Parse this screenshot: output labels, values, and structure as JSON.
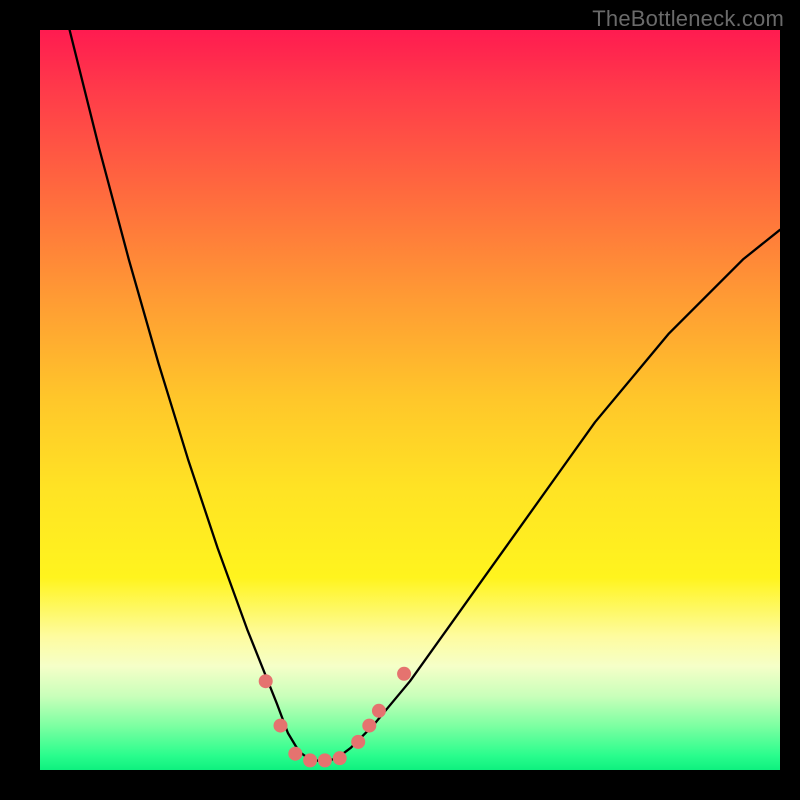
{
  "watermark": "TheBottleneck.com",
  "chart_data": {
    "type": "line",
    "title": "",
    "xlabel": "",
    "ylabel": "",
    "xlim": [
      0,
      100
    ],
    "ylim": [
      0,
      100
    ],
    "grid": false,
    "legend": false,
    "series": [
      {
        "name": "bottleneck-curve",
        "color": "#000000",
        "x": [
          4,
          8,
          12,
          16,
          20,
          24,
          28,
          30,
          32,
          33.5,
          35,
          36.5,
          38,
          40,
          42,
          45,
          50,
          55,
          60,
          65,
          70,
          75,
          80,
          85,
          90,
          95,
          100
        ],
        "y": [
          100,
          84,
          69,
          55,
          42,
          30,
          19,
          14,
          9,
          5,
          2.5,
          1.4,
          1.2,
          1.5,
          3,
          6,
          12,
          19,
          26,
          33,
          40,
          47,
          53,
          59,
          64,
          69,
          73
        ]
      }
    ],
    "markers": {
      "name": "highlight-points",
      "color": "#e5736f",
      "radius": 7,
      "points": [
        {
          "x": 30.5,
          "y": 12
        },
        {
          "x": 32.5,
          "y": 6
        },
        {
          "x": 34.5,
          "y": 2.2
        },
        {
          "x": 36.5,
          "y": 1.3
        },
        {
          "x": 38.5,
          "y": 1.3
        },
        {
          "x": 40.5,
          "y": 1.6
        },
        {
          "x": 43.0,
          "y": 3.8
        },
        {
          "x": 44.5,
          "y": 6
        },
        {
          "x": 45.8,
          "y": 8
        },
        {
          "x": 49.2,
          "y": 13
        }
      ]
    }
  }
}
